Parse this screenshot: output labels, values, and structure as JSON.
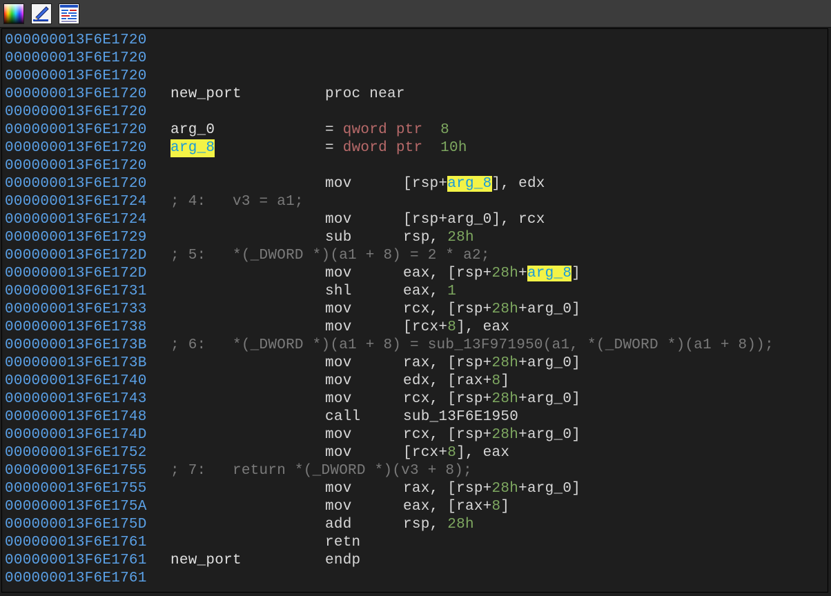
{
  "toolbar": {
    "buttons": [
      {
        "name": "graph-colors-icon"
      },
      {
        "name": "edit-icon"
      },
      {
        "name": "text-view-icon"
      }
    ]
  },
  "listing": {
    "lines": [
      {
        "addr": "000000013F6E1720",
        "label": "",
        "op": "",
        "args": []
      },
      {
        "addr": "000000013F6E1720",
        "label": "",
        "op": "",
        "args": []
      },
      {
        "addr": "000000013F6E1720",
        "label": "",
        "op": "",
        "args": []
      },
      {
        "addr": "000000013F6E1720",
        "label": "new_port",
        "op": "proc near",
        "args": []
      },
      {
        "addr": "000000013F6E1720",
        "label": "",
        "op": "",
        "args": []
      },
      {
        "addr": "000000013F6E1720",
        "label": "arg_0",
        "op": "=",
        "args": [
          {
            "t": " "
          },
          {
            "t": "qword ptr",
            "c": "type"
          },
          {
            "t": "  "
          },
          {
            "t": "8",
            "c": "num"
          }
        ],
        "opArgsInline": true
      },
      {
        "addr": "000000013F6E1720",
        "label": "arg_8",
        "labelHL": true,
        "op": "=",
        "args": [
          {
            "t": " "
          },
          {
            "t": "dword ptr",
            "c": "type"
          },
          {
            "t": "  "
          },
          {
            "t": "10h",
            "c": "num"
          }
        ],
        "opArgsInline": true
      },
      {
        "addr": "000000013F6E1720",
        "label": "",
        "op": "",
        "args": []
      },
      {
        "addr": "000000013F6E1720",
        "label": "",
        "op": "mov",
        "args": [
          {
            "t": "[rsp+"
          },
          {
            "t": "arg_8",
            "c": "hl"
          },
          {
            "t": "], edx"
          }
        ]
      },
      {
        "addr": "000000013F6E1724",
        "comment": "; 4:   v3 = a1;"
      },
      {
        "addr": "000000013F6E1724",
        "label": "",
        "op": "mov",
        "args": [
          {
            "t": "[rsp+arg_0], rcx"
          }
        ]
      },
      {
        "addr": "000000013F6E1729",
        "label": "",
        "op": "sub",
        "args": [
          {
            "t": "rsp, "
          },
          {
            "t": "28h",
            "c": "num"
          }
        ]
      },
      {
        "addr": "000000013F6E172D",
        "comment": "; 5:   *(_DWORD *)(a1 + 8) = 2 * a2;"
      },
      {
        "addr": "000000013F6E172D",
        "label": "",
        "op": "mov",
        "args": [
          {
            "t": "eax, [rsp+"
          },
          {
            "t": "28h",
            "c": "num"
          },
          {
            "t": "+"
          },
          {
            "t": "arg_8",
            "c": "hl"
          },
          {
            "t": "]"
          }
        ]
      },
      {
        "addr": "000000013F6E1731",
        "label": "",
        "op": "shl",
        "args": [
          {
            "t": "eax, "
          },
          {
            "t": "1",
            "c": "num"
          }
        ]
      },
      {
        "addr": "000000013F6E1733",
        "label": "",
        "op": "mov",
        "args": [
          {
            "t": "rcx, [rsp+"
          },
          {
            "t": "28h",
            "c": "num"
          },
          {
            "t": "+arg_0]"
          }
        ]
      },
      {
        "addr": "000000013F6E1738",
        "label": "",
        "op": "mov",
        "args": [
          {
            "t": "[rcx+"
          },
          {
            "t": "8",
            "c": "num"
          },
          {
            "t": "], eax"
          }
        ]
      },
      {
        "addr": "000000013F6E173B",
        "comment": "; 6:   *(_DWORD *)(a1 + 8) = sub_13F971950(a1, *(_DWORD *)(a1 + 8));"
      },
      {
        "addr": "000000013F6E173B",
        "label": "",
        "op": "mov",
        "args": [
          {
            "t": "rax, [rsp+"
          },
          {
            "t": "28h",
            "c": "num"
          },
          {
            "t": "+arg_0]"
          }
        ]
      },
      {
        "addr": "000000013F6E1740",
        "label": "",
        "op": "mov",
        "args": [
          {
            "t": "edx, [rax+"
          },
          {
            "t": "8",
            "c": "num"
          },
          {
            "t": "]"
          }
        ]
      },
      {
        "addr": "000000013F6E1743",
        "label": "",
        "op": "mov",
        "args": [
          {
            "t": "rcx, [rsp+"
          },
          {
            "t": "28h",
            "c": "num"
          },
          {
            "t": "+arg_0]"
          }
        ]
      },
      {
        "addr": "000000013F6E1748",
        "label": "",
        "op": "call",
        "args": [
          {
            "t": "sub_13F6E1950"
          }
        ]
      },
      {
        "addr": "000000013F6E174D",
        "label": "",
        "op": "mov",
        "args": [
          {
            "t": "rcx, [rsp+"
          },
          {
            "t": "28h",
            "c": "num"
          },
          {
            "t": "+arg_0]"
          }
        ]
      },
      {
        "addr": "000000013F6E1752",
        "label": "",
        "op": "mov",
        "args": [
          {
            "t": "[rcx+"
          },
          {
            "t": "8",
            "c": "num"
          },
          {
            "t": "], eax"
          }
        ]
      },
      {
        "addr": "000000013F6E1755",
        "comment": "; 7:   return *(_DWORD *)(v3 + 8);"
      },
      {
        "addr": "000000013F6E1755",
        "label": "",
        "op": "mov",
        "args": [
          {
            "t": "rax, [rsp+"
          },
          {
            "t": "28h",
            "c": "num"
          },
          {
            "t": "+arg_0]"
          }
        ]
      },
      {
        "addr": "000000013F6E175A",
        "label": "",
        "op": "mov",
        "args": [
          {
            "t": "eax, [rax+"
          },
          {
            "t": "8",
            "c": "num"
          },
          {
            "t": "]"
          }
        ]
      },
      {
        "addr": "000000013F6E175D",
        "label": "",
        "op": "add",
        "args": [
          {
            "t": "rsp, "
          },
          {
            "t": "28h",
            "c": "num"
          }
        ]
      },
      {
        "addr": "000000013F6E1761",
        "label": "",
        "op": "retn",
        "args": []
      },
      {
        "addr": "000000013F6E1761",
        "label": "new_port",
        "op": "endp",
        "args": []
      },
      {
        "addr": "000000013F6E1761",
        "label": "",
        "op": "",
        "args": []
      }
    ]
  },
  "colors": {
    "background": "#1e1e1e",
    "address": "#5aa0e6",
    "number": "#7ea860",
    "type": "#b86a6a",
    "comment": "#7a7a7a",
    "highlight": "#f3f346"
  }
}
